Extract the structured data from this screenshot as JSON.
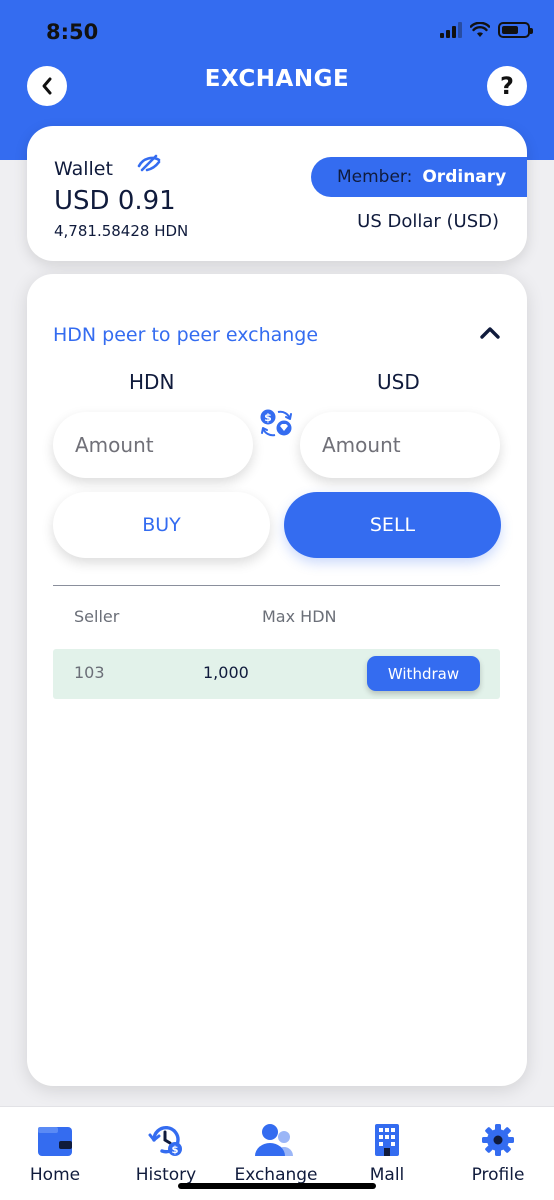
{
  "status_bar": {
    "time": "8:50"
  },
  "header": {
    "title": "EXCHANGE",
    "back_icon": "chevron-left-icon",
    "help_label": "?"
  },
  "wallet": {
    "label": "Wallet",
    "balance": "USD 0.91",
    "hdn_balance": "4,781.58428 HDN",
    "member_key": "Member:",
    "member_value": "Ordinary",
    "currency": "US Dollar (USD)"
  },
  "exchange": {
    "section_title": "HDN peer to peer exchange",
    "col_left": "HDN",
    "col_right": "USD",
    "amount_placeholder_left": "Amount",
    "amount_placeholder_right": "Amount",
    "buy_label": "BUY",
    "sell_label": "SELL",
    "table_headers": {
      "seller": "Seller",
      "max": "Max HDN"
    },
    "rows": [
      {
        "seller": "103",
        "max": "1,000",
        "action": "Withdraw"
      }
    ]
  },
  "tabs": [
    {
      "label": "Home",
      "icon": "wallet-icon"
    },
    {
      "label": "History",
      "icon": "history-icon"
    },
    {
      "label": "Exchange",
      "icon": "users-icon"
    },
    {
      "label": "Mall",
      "icon": "building-icon"
    },
    {
      "label": "Profile",
      "icon": "gear-icon"
    }
  ],
  "colors": {
    "primary": "#346cf0",
    "text": "#101b3c",
    "row_bg": "#e2f2ea"
  }
}
